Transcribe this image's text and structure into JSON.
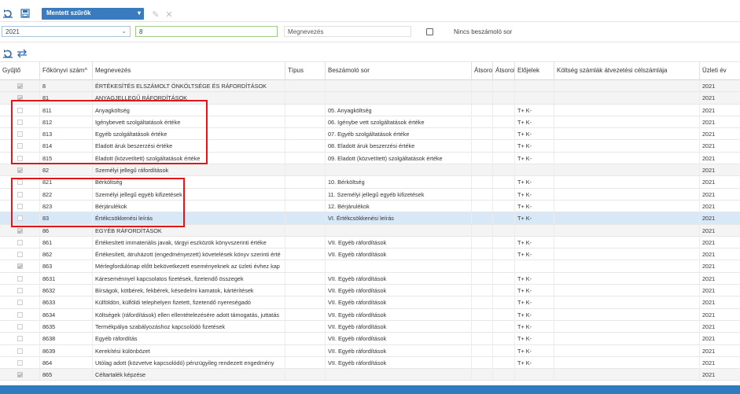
{
  "toolbar": {
    "saved_filters_label": "Mentett szűrők",
    "icons": [
      "refresh-icon",
      "save-icon",
      "edit-icon",
      "delete-icon"
    ]
  },
  "filters": {
    "year_value": "2021",
    "code_value": "8",
    "name_placeholder": "Megnevezés",
    "no_report_row_label": "Nincs beszámoló sor"
  },
  "columns": [
    "Gyűjtő",
    "Főkönyvi szám^",
    "Megnevezés",
    "Típus",
    "Beszámoló sor",
    "Átsorol",
    "Átsorol",
    "Előjelek",
    "Költség számlák átvezetési célszámlája",
    "Üzleti év"
  ],
  "rows": [
    {
      "checked": true,
      "code": "8",
      "name": "ÉRTÉKESÍTÉS ELSZÁMOLT ÖNKÖLTSÉGE ÉS RÁFORDÍTÁSOK",
      "report": "",
      "sign": "",
      "year": "2021"
    },
    {
      "checked": true,
      "code": "81",
      "name": "ANYAGJELLEGŰ RÁFORDÍTÁSOK",
      "report": "",
      "sign": "",
      "year": "2021"
    },
    {
      "checked": false,
      "code": "811",
      "name": "Anyagköltség",
      "report": "05. Anyagköltség",
      "sign": "T+ K-",
      "year": "2021"
    },
    {
      "checked": false,
      "code": "812",
      "name": "Igénybevett szolgáltatások értéke",
      "report": "06. Igénybe vett szolgáltatások értéke",
      "sign": "T+ K-",
      "year": "2021"
    },
    {
      "checked": false,
      "code": "813",
      "name": "Egyéb szolgáltatások értéke",
      "report": "07. Egyéb szolgáltatások értéke",
      "sign": "T+ K-",
      "year": "2021"
    },
    {
      "checked": false,
      "code": "814",
      "name": "Eladott áruk beszerzési értéke",
      "report": "08. Eladott áruk beszerzési értéke",
      "sign": "T+ K-",
      "year": "2021"
    },
    {
      "checked": false,
      "code": "815",
      "name": "Eladott (közvetített) szolgáltatások értéke",
      "report": "09. Eladott (közvetített) szolgáltatások értéke",
      "sign": "T+ K-",
      "year": "2021"
    },
    {
      "checked": true,
      "code": "82",
      "name": "Személyi jellegű ráfordítások",
      "report": "",
      "sign": "",
      "year": "2021"
    },
    {
      "checked": false,
      "code": "821",
      "name": "Bérköltség",
      "report": "10. Bérköltség",
      "sign": "T+ K-",
      "year": "2021"
    },
    {
      "checked": false,
      "code": "822",
      "name": "Személyi jellegű egyéb kifizetések",
      "report": "11. Személyi jellegű egyéb kifizetések",
      "sign": "T+ K-",
      "year": "2021"
    },
    {
      "checked": false,
      "code": "823",
      "name": "Bérjárulékok",
      "report": "12. Bérjárulékok",
      "sign": "T+ K-",
      "year": "2021"
    },
    {
      "checked": false,
      "code": "83",
      "name": "Értékcsökkenési leírás",
      "report": "VI. Értékcsökkenési leírás",
      "sign": "T+ K-",
      "year": "2021"
    },
    {
      "checked": true,
      "code": "86",
      "name": "EGYÉB RÁFORDÍTÁSOK",
      "report": "",
      "sign": "",
      "year": "2021"
    },
    {
      "checked": false,
      "code": "861",
      "name": "Értékesített immateriális javak, tárgyi eszközök könyvszerinti értéke",
      "report": "VII. Egyéb ráfordítások",
      "sign": "T+ K-",
      "year": "2021"
    },
    {
      "checked": false,
      "code": "862",
      "name": "Értékesített, átruházott (engedményezett) követelések könyv szerinti érté",
      "report": "VII. Egyéb ráfordítások",
      "sign": "T+ K-",
      "year": "2021"
    },
    {
      "checked": true,
      "code": "863",
      "name": "Mérlegfordulónap előtt bekövetkezett eseményeknek az üzleti évhez kap",
      "report": "",
      "sign": "",
      "year": "2021"
    },
    {
      "checked": false,
      "code": "8631",
      "name": "Káreseménnyel kapcsolatos fizetések, fizetendő összegek",
      "report": "VII. Egyéb ráfordítások",
      "sign": "T+ K-",
      "year": "2021"
    },
    {
      "checked": false,
      "code": "8632",
      "name": "Bírságok, kötbérek, fekbérek, késedelmi kamatok, kártérítések",
      "report": "VII. Egyéb ráfordítások",
      "sign": "T+ K-",
      "year": "2021"
    },
    {
      "checked": false,
      "code": "8633",
      "name": "Külföldön, külföldi telephelyen fizetett, fizetendő nyereségadó",
      "report": "VII. Egyéb ráfordítások",
      "sign": "T+ K-",
      "year": "2021"
    },
    {
      "checked": false,
      "code": "8634",
      "name": "Költségek (ráfordítások) ellen ellentételezésére adott támogatás, juttatás",
      "report": "VII. Egyéb ráfordítások",
      "sign": "T+ K-",
      "year": "2021"
    },
    {
      "checked": false,
      "code": "8635",
      "name": "Termékpálya szabályozáshoz kapcsolódó fizetések",
      "report": "VII. Egyéb ráfordítások",
      "sign": "T+ K-",
      "year": "2021"
    },
    {
      "checked": false,
      "code": "8638",
      "name": "Egyéb ráfordítás",
      "report": "VII. Egyéb ráfordítások",
      "sign": "T+ K-",
      "year": "2021"
    },
    {
      "checked": false,
      "code": "8639",
      "name": "Kerekítési különbözet",
      "report": "VII. Egyéb ráfordítások",
      "sign": "T+ K-",
      "year": "2021"
    },
    {
      "checked": false,
      "code": "864",
      "name": "Utólag adott (közvetve kapcsolódó) pénzügyileg rendezett engedmény",
      "report": "VII. Egyéb ráfordítások",
      "sign": "T+ K-",
      "year": "2021"
    },
    {
      "checked": true,
      "code": "865",
      "name": "Céltartalék képzése",
      "report": "",
      "sign": "",
      "year": "2021"
    }
  ],
  "selected_row": "83",
  "colors": {
    "accent": "#3a7bbf",
    "highlight_box": "#e0161a",
    "selected": "#d9e8f7"
  }
}
